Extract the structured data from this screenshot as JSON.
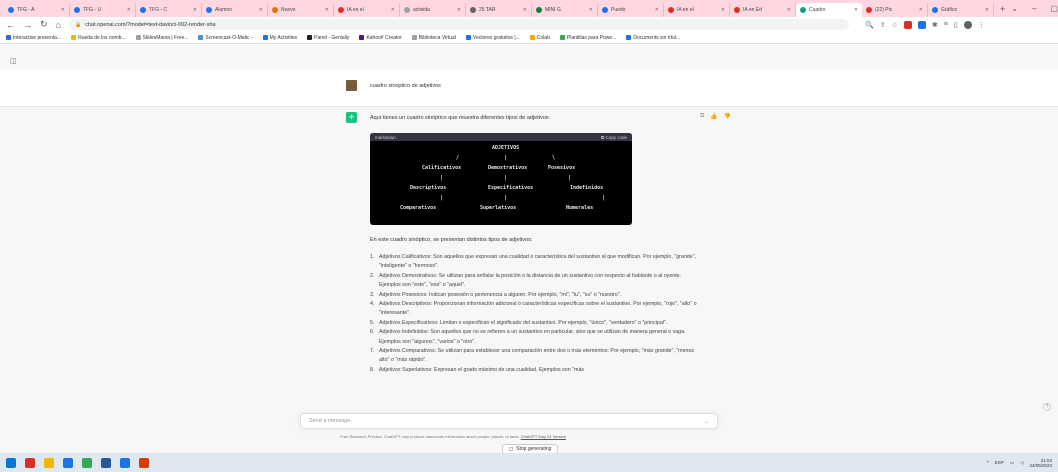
{
  "browser": {
    "tabs": [
      {
        "label": "TFG - A",
        "color": "#1a73e8"
      },
      {
        "label": "TFG - U",
        "color": "#1a73e8"
      },
      {
        "label": "TFG - C",
        "color": "#1a73e8"
      },
      {
        "label": "Alumno",
        "color": "#1a73e8"
      },
      {
        "label": "Nuevo",
        "color": "#e8710a"
      },
      {
        "label": "IA en el",
        "color": "#d93025"
      },
      {
        "label": "activida",
        "color": "#9aa0a6"
      },
      {
        "label": "25 TAR",
        "color": "#5f6368"
      },
      {
        "label": "MINI G",
        "color": "#188038"
      },
      {
        "label": "Puedo",
        "color": "#1a73e8"
      },
      {
        "label": "IA en el",
        "color": "#d93025"
      },
      {
        "label": "IA en Ed",
        "color": "#d93025"
      },
      {
        "label": "Cuadro",
        "color": "#10a37f",
        "active": true
      },
      {
        "label": "(22) Pic",
        "color": "#d93025"
      },
      {
        "label": "Gráfico",
        "color": "#1a73e8"
      }
    ],
    "new_tab": "+",
    "window_controls": [
      "⌄",
      "–",
      "▢",
      "✕"
    ],
    "url": "chat.openai.com/?model=text-davinci-002-render-sha"
  },
  "bookmarks": [
    {
      "label": "Interactive presenta...",
      "color": "#2b6de0"
    },
    {
      "label": "Rueda de los nomb...",
      "color": "#f4b400"
    },
    {
      "label": "SlidesMania | Free...",
      "color": "#9aa0a6"
    },
    {
      "label": "Screencast-O-Matic -",
      "color": "#4a90d9"
    },
    {
      "label": "My Activities",
      "color": "#1a73e8"
    },
    {
      "label": "Panel - Genially",
      "color": "#202124"
    },
    {
      "label": "Kahoot! Creator",
      "color": "#46178f"
    },
    {
      "label": "Biblioteca Virtual",
      "color": "#9aa0a6"
    },
    {
      "label": "Vectores gratuitos |...",
      "color": "#1a73e8"
    },
    {
      "label": "Colab",
      "color": "#f9ab00"
    },
    {
      "label": "Plantillas para Powe...",
      "color": "#34a853"
    },
    {
      "label": "Documents sin títul...",
      "color": "#1a73e8"
    }
  ],
  "chat": {
    "user_message": "cuadro sinoptico de adjetivos",
    "assistant_intro": "Aquí tienes un cuadro sinóptico que muestra diferentes tipos de adjetivos:",
    "code": {
      "language": "markdown",
      "copy_label": "Copy code",
      "lines": {
        "root": "ADJETIVOS",
        "slash": "/",
        "pipe_mid": "|",
        "backslash": "\\",
        "l1_left": "Calificativos",
        "l1_mid": "Demostrativos",
        "l1_right": "Posesivos",
        "pipe_a": "|",
        "pipe_b": "|",
        "pipe_c": "|",
        "l2_left": "Descriptivos",
        "l2_mid": "Especificativos",
        "l2_right": "Indefinidos",
        "pipe_d": "|",
        "pipe_e": "|",
        "pipe_f": "|",
        "l3_left": "Comparativos",
        "l3_mid": "Superlativos",
        "l3_right": "Numerales"
      }
    },
    "summary": "En este cuadro sinóptico, se presentan distintos tipos de adjetivos:",
    "items": [
      {
        "num": "1.",
        "text": "Adjetivos Calificativos: Son aquellos que expresan una cualidad o característica del sustantivo al que modifican. Por ejemplo, \"grande\", \"inteligente\" o \"hermoso\"."
      },
      {
        "num": "2.",
        "text": "Adjetivos Demostrativos: Se utilizan para señalar la posición o la distancia de un sustantivo con respecto al hablante o al oyente. Ejemplos son \"este\", \"ese\" o \"aquel\"."
      },
      {
        "num": "3.",
        "text": "Adjetivos Posesivos: Indican posesión o pertenencia a alguien. Por ejemplo, \"mi\", \"tu\", \"su\" o \"nuestro\"."
      },
      {
        "num": "4.",
        "text": "Adjetivos Descriptivos: Proporcionan información adicional o características específicas sobre el sustantivo. Por ejemplo, \"rojo\", \"alto\" o \"interesante\"."
      },
      {
        "num": "5.",
        "text": "Adjetivos Especificativos: Limitan o especifican el significado del sustantivo. Por ejemplo, \"único\", \"verdadero\" o \"principal\"."
      },
      {
        "num": "6.",
        "text": "Adjetivos Indefinidos: Son aquellos que no se refieren a un sustantivo en particular, sino que se utilizan de manera general o vaga. Ejemplos son \"algunos\", \"varios\" o \"otro\"."
      },
      {
        "num": "7.",
        "text": "Adjetivos Comparativos: Se utilizan para establecer una comparación entre dos o más elementos. Por ejemplo, \"más grande\", \"menos alto\" o \"más rápido\"."
      },
      {
        "num": "8.",
        "text": "Adjetivos Superlativos: Expresan el grado máximo de una cualidad. Ejemplos son \"más"
      }
    ],
    "stop_label": "Stop generating",
    "composer_placeholder": "Send a message.",
    "disclaimer": "Free Research Preview. ChatGPT may produce inaccurate information about people, places, or facts.",
    "disclaimer_link": "ChatGPT May 24 Version"
  },
  "taskbar": {
    "apps": [
      "#0078d4",
      "#d93025",
      "#f4b400",
      "#1a73e8",
      "#34a853",
      "#2b579a",
      "#1a73e8",
      "#d83b01"
    ],
    "lang": "ESP",
    "time": "21:04",
    "date": "24/05/2023"
  }
}
